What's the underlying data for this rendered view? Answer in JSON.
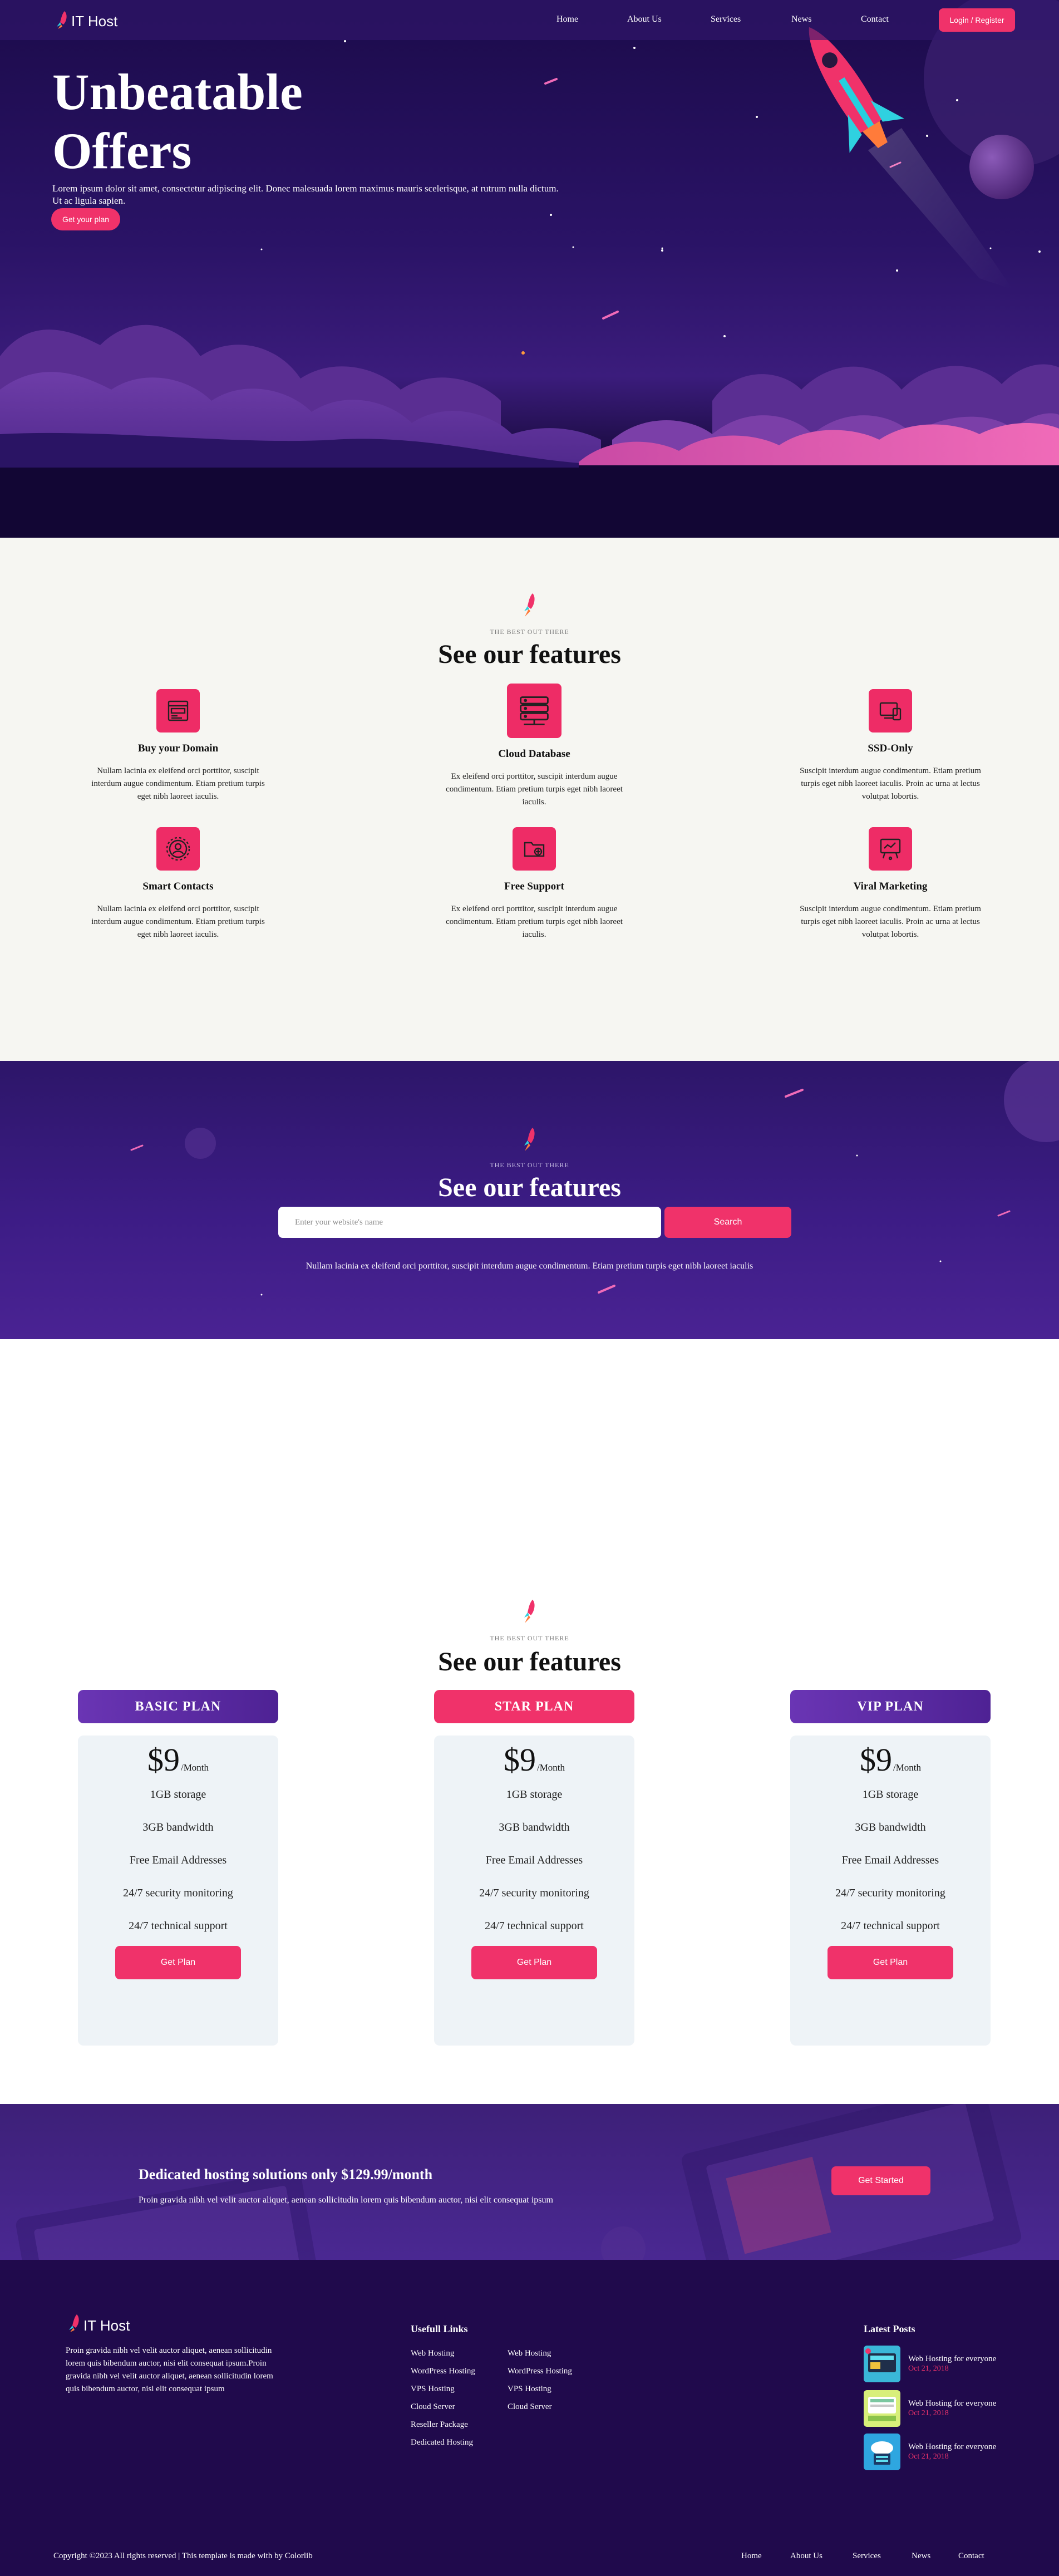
{
  "brand": {
    "name": "IT Host"
  },
  "nav": {
    "items": [
      "Home",
      "About Us",
      "Services",
      "News",
      "Contact"
    ],
    "login_label": "Login / Register"
  },
  "hero": {
    "title": "Unbeatable Offers",
    "text": "Lorem ipsum dolor sit amet, consectetur adipiscing elit. Donec malesuada lorem maximus mauris scelerisque, at rutrum nulla dictum. Ut ac ligula sapien.",
    "button_label": "Get your plan"
  },
  "features": {
    "eyebrow": "THE BEST OUT THERE",
    "title": "See our features",
    "items": [
      {
        "icon": "domain-icon",
        "title": "Buy your Domain",
        "text": "Nullam lacinia ex eleifend orci porttitor, suscipit interdum augue condimentum. Etiam pretium turpis eget nibh laoreet iaculis."
      },
      {
        "icon": "database-icon",
        "title": "Cloud Database",
        "text": "Ex eleifend orci porttitor, suscipit interdum augue condimentum. Etiam pretium turpis eget nibh laoreet iaculis."
      },
      {
        "icon": "devices-icon",
        "title": "SSD-Only",
        "text": "Suscipit interdum augue condimentum. Etiam pretium turpis eget nibh laoreet iaculis. Proin ac urna at lectus volutpat lobortis."
      },
      {
        "icon": "contacts-icon",
        "title": "Smart Contacts",
        "text": "Nullam lacinia ex eleifend orci porttitor, suscipit interdum augue condimentum. Etiam pretium turpis eget nibh laoreet iaculis."
      },
      {
        "icon": "support-icon",
        "title": "Free Support",
        "text": "Ex eleifend orci porttitor, suscipit interdum augue condimentum. Etiam pretium turpis eget nibh laoreet iaculis."
      },
      {
        "icon": "marketing-icon",
        "title": "Viral Marketing",
        "text": "Suscipit interdum augue condimentum. Etiam pretium turpis eget nibh laoreet iaculis. Proin ac urna at lectus volutpat lobortis."
      }
    ]
  },
  "search": {
    "eyebrow": "THE BEST OUT THERE",
    "title": "See our features",
    "placeholder": "Enter your website's name",
    "button_label": "Search",
    "note": "Nullam lacinia ex eleifend orci porttitor, suscipit interdum augue condimentum. Etiam pretium turpis eget nibh laoreet iaculis"
  },
  "pricing": {
    "eyebrow": "THE BEST OUT THERE",
    "title": "See our features",
    "plans": [
      {
        "name": "BASIC PLAN",
        "price": "$9",
        "period": "/Month",
        "features": [
          "1GB storage",
          "3GB bandwidth",
          "Free Email Addresses",
          "24/7 security monitoring",
          "24/7 technical support"
        ],
        "button": "Get Plan"
      },
      {
        "name": "STAR PLAN",
        "price": "$9",
        "period": "/Month",
        "features": [
          "1GB storage",
          "3GB bandwidth",
          "Free Email Addresses",
          "24/7 security monitoring",
          "24/7 technical support"
        ],
        "button": "Get Plan"
      },
      {
        "name": "VIP PLAN",
        "price": "$9",
        "period": "/Month",
        "features": [
          "1GB storage",
          "3GB bandwidth",
          "Free Email Addresses",
          "24/7 security monitoring",
          "24/7 technical support"
        ],
        "button": "Get Plan"
      }
    ]
  },
  "cta": {
    "title": "Dedicated hosting solutions only $129.99/month",
    "text": "Proin gravida nibh vel velit auctor aliquet, aenean sollicitudin lorem quis bibendum auctor, nisi elit consequat ipsum",
    "button_label": "Get Started"
  },
  "footer": {
    "about": "Proin gravida nibh vel velit auctor aliquet, aenean sollicitudin lorem quis bibendum auctor, nisi elit consequat ipsum.Proin gravida nibh vel velit auctor aliquet, aenean sollicitudin lorem quis bibendum auctor, nisi elit consequat ipsum",
    "links_title": "Usefull Links",
    "links_col1": [
      "Web Hosting",
      "WordPress Hosting",
      "VPS Hosting",
      "Cloud Server",
      "Reseller Package",
      "Dedicated Hosting"
    ],
    "links_col2": [
      "Web Hosting",
      "WordPress Hosting",
      "VPS Hosting",
      "Cloud Server"
    ],
    "posts_title": "Latest Posts",
    "posts": [
      {
        "title": "Web Hosting for everyone",
        "date": "Oct 21, 2018"
      },
      {
        "title": "Web Hosting for everyone",
        "date": "Oct 21, 2018"
      },
      {
        "title": "Web Hosting for everyone",
        "date": "Oct 21, 2018"
      }
    ],
    "copyright": "Copyright ©2023 All rights reserved | This template is made with by Colorlib",
    "bottom_nav": [
      "Home",
      "About Us",
      "Services",
      "News",
      "Contact"
    ]
  },
  "colors": {
    "accent": "#f0326a",
    "hero_dark": "#1c0b4b",
    "footer_bg": "#200a4c",
    "card_bg": "#eef3f7",
    "feature_bg": "#f6f6f2"
  }
}
